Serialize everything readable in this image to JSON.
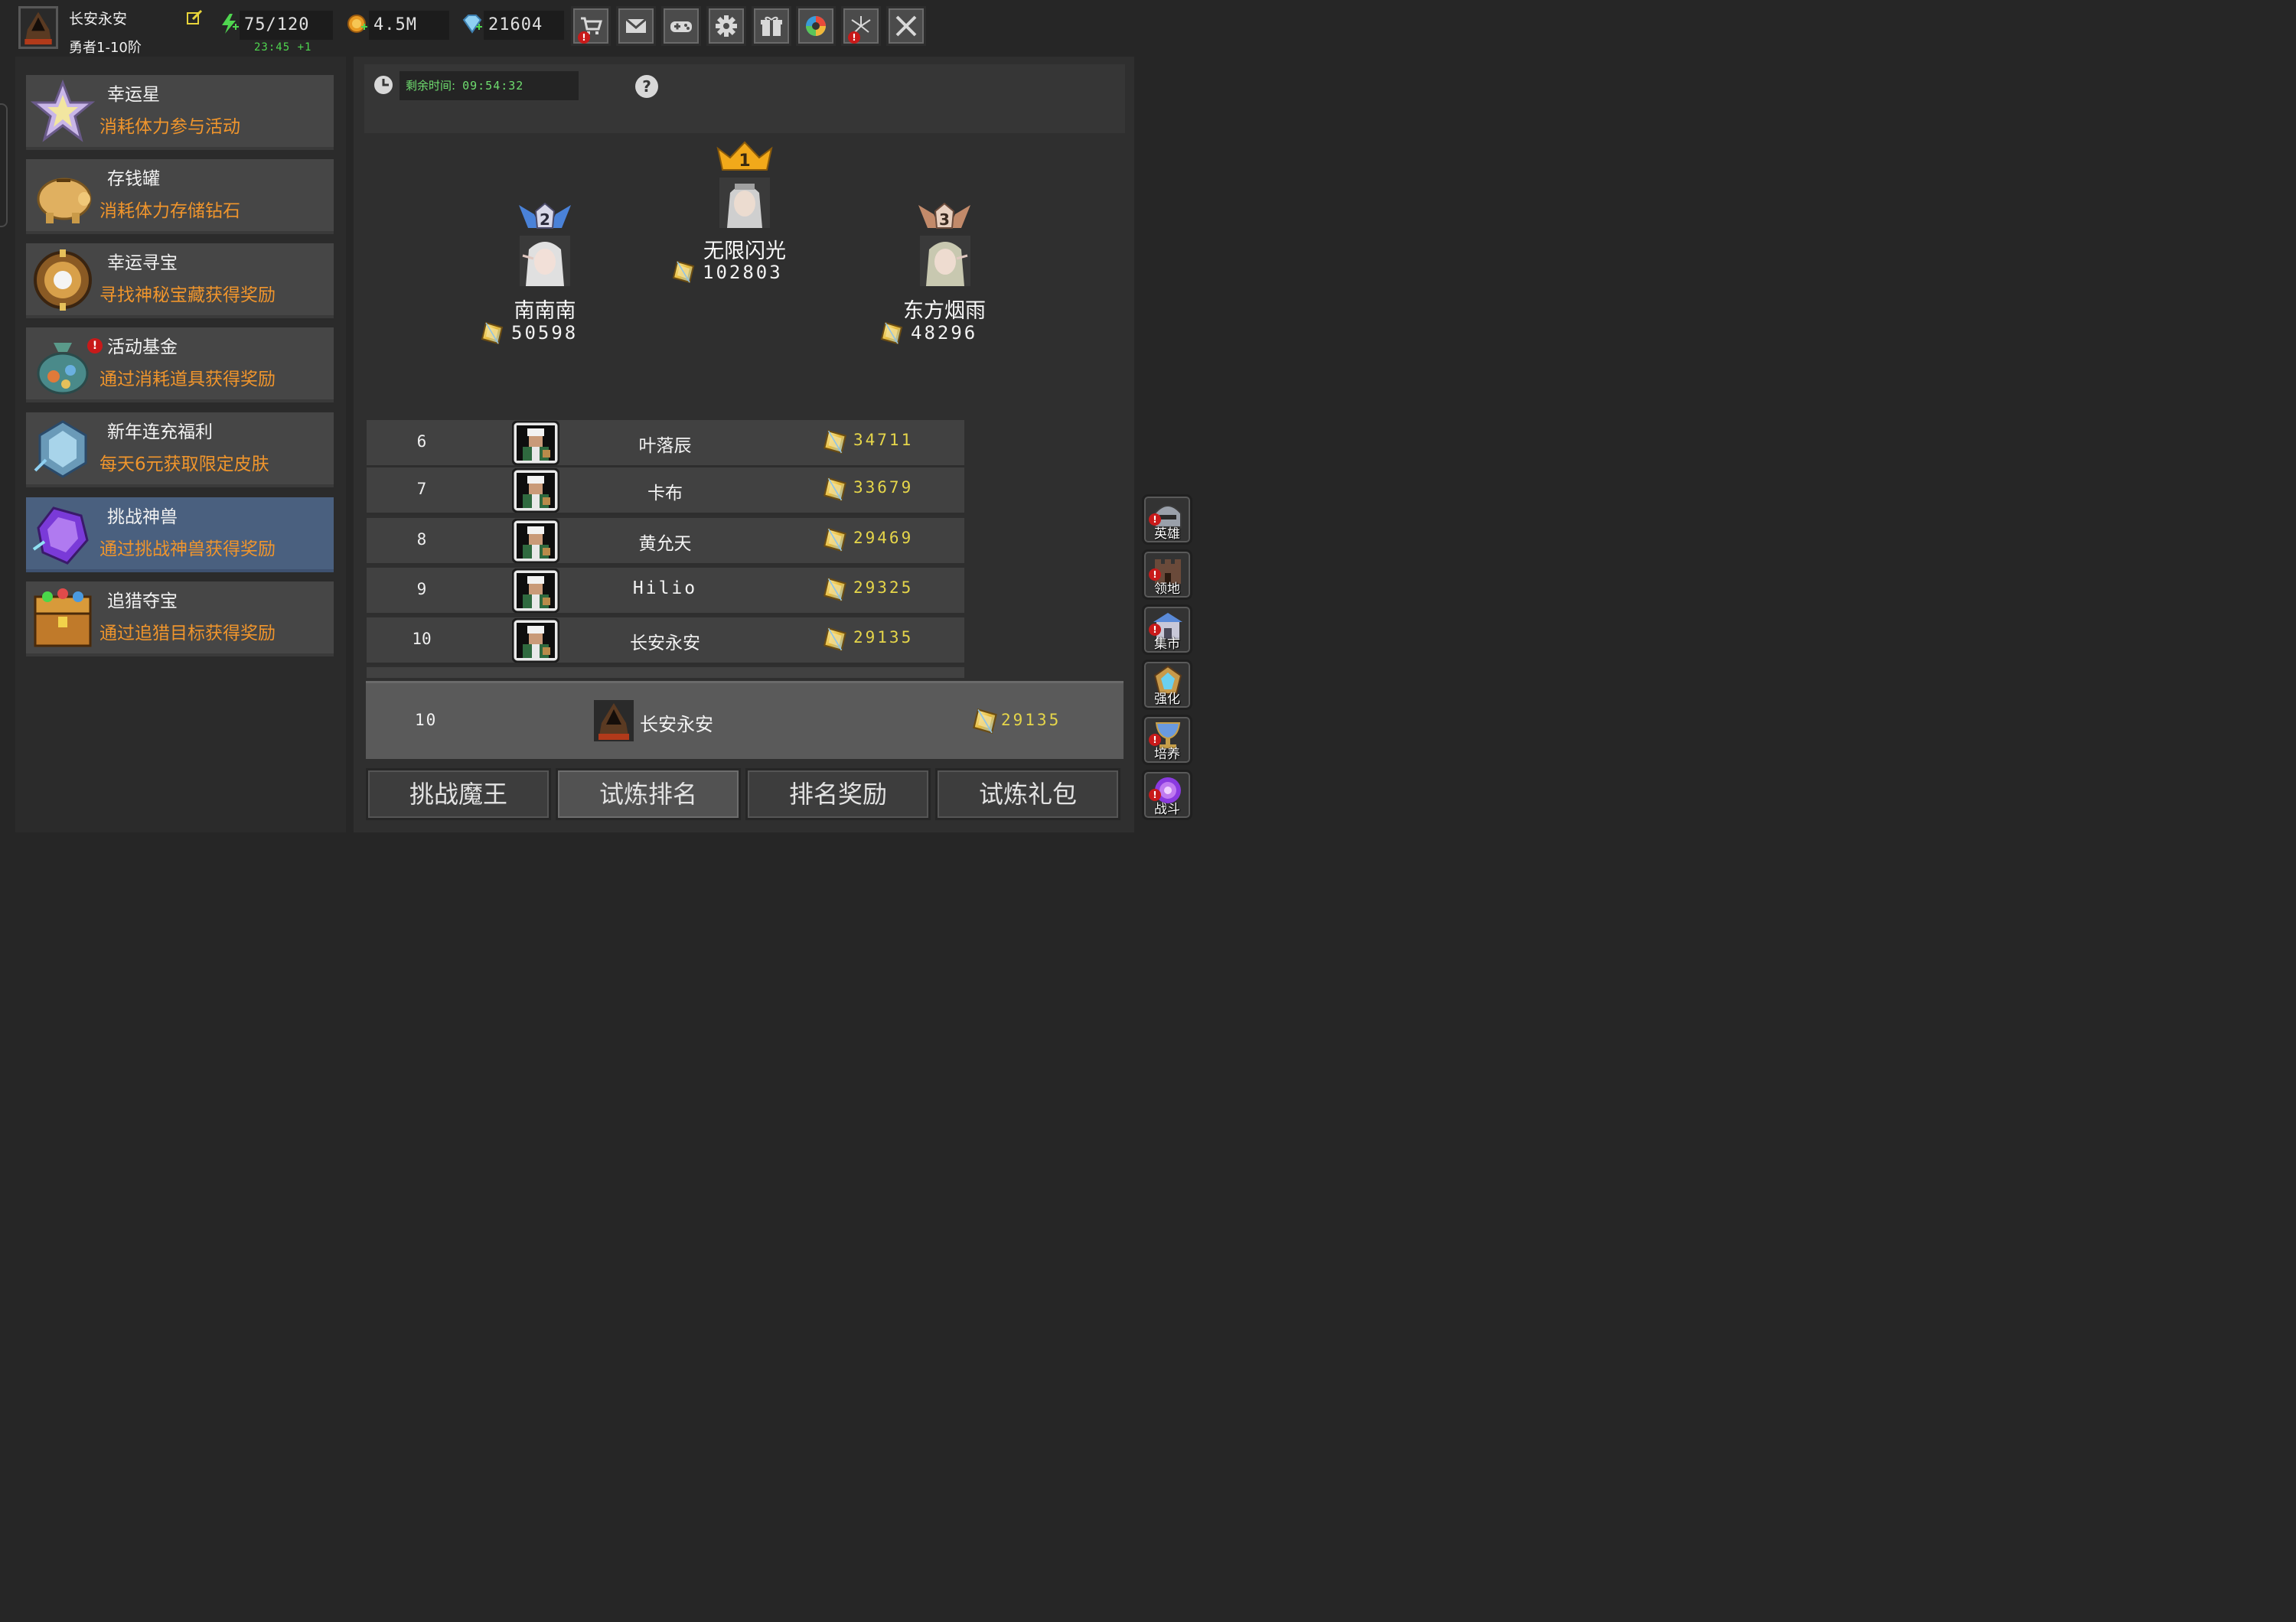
{
  "player": {
    "name": "长安永安",
    "rank": "勇者1-10阶"
  },
  "resources": {
    "stamina": "75/120",
    "stamina_regen": "23:45 +1",
    "gold": "4.5M",
    "gems": "21604"
  },
  "top_icons": [
    "cart-icon",
    "mail-icon",
    "gamepad-icon",
    "gear-icon",
    "gift-icon",
    "aperture-icon",
    "fireworks-icon",
    "crossed-swords-icon"
  ],
  "activities": [
    {
      "title": "幸运星",
      "desc": "消耗体力参与活动",
      "icon": "lucky-star-icon"
    },
    {
      "title": "存钱罐",
      "desc": "消耗体力存储钻石",
      "icon": "piggy-bank-icon"
    },
    {
      "title": "幸运寻宝",
      "desc": "寻找神秘宝藏获得奖励",
      "icon": "treasure-compass-icon"
    },
    {
      "title": "活动基金",
      "desc": "通过消耗道具获得奖励",
      "icon": "fund-bag-icon",
      "alert": "!"
    },
    {
      "title": "新年连充福利",
      "desc": "每天6元获取限定皮肤",
      "icon": "ice-crystal-icon"
    },
    {
      "title": "挑战神兽",
      "desc": "通过挑战神兽获得奖励",
      "icon": "purple-beast-icon",
      "active": true
    },
    {
      "title": "追猎夺宝",
      "desc": "通过追猎目标获得奖励",
      "icon": "treasure-chest-icon"
    }
  ],
  "timer": {
    "label": "剩余时间:",
    "value": "09:54:32"
  },
  "podium": [
    {
      "place": "1",
      "name": "无限闪光",
      "score": "102803"
    },
    {
      "place": "2",
      "name": "南南南",
      "score": "50598"
    },
    {
      "place": "3",
      "name": "东方烟雨",
      "score": "48296"
    }
  ],
  "ranking": [
    {
      "rank": "6",
      "name": "叶落辰",
      "score": "34711"
    },
    {
      "rank": "7",
      "name": "卡布",
      "score": "33679"
    },
    {
      "rank": "8",
      "name": "黄允天",
      "score": "29469"
    },
    {
      "rank": "9",
      "name": "Hilio",
      "score": "29325"
    },
    {
      "rank": "10",
      "name": "长安永安",
      "score": "29135"
    }
  ],
  "my_rank": {
    "rank": "10",
    "name": "长安永安",
    "score": "29135"
  },
  "tabs": [
    {
      "label": "挑战魔王"
    },
    {
      "label": "试炼排名",
      "active": true
    },
    {
      "label": "排名奖励"
    },
    {
      "label": "试炼礼包"
    }
  ],
  "side_menu": [
    {
      "label": "英雄",
      "icon": "helmet-icon",
      "alert": "!"
    },
    {
      "label": "领地",
      "icon": "castle-icon",
      "alert": "!"
    },
    {
      "label": "集市",
      "icon": "market-icon",
      "alert": "!"
    },
    {
      "label": "强化",
      "icon": "enhance-gem-icon"
    },
    {
      "label": "培养",
      "icon": "chalice-icon",
      "alert": "!"
    },
    {
      "label": "战斗",
      "icon": "portal-icon",
      "alert": "!"
    }
  ],
  "colors": {
    "accent_orange": "#f0952c",
    "active_item": "#4a607f",
    "score_yellow": "#e6d64a",
    "timer_green": "#6fdd6f",
    "alert_red": "#c81a1a"
  }
}
